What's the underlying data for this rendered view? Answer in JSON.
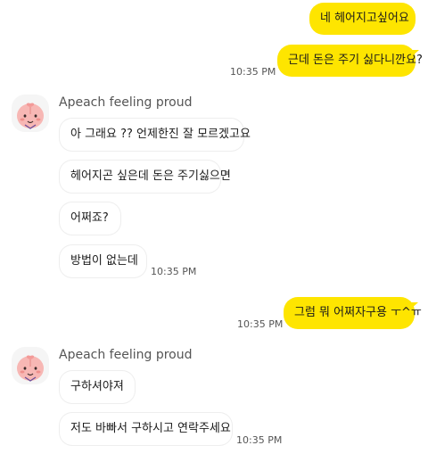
{
  "colors": {
    "my_bubble": "#fee500",
    "their_bubble": "#ffffff",
    "background": "#ffffff",
    "time_text": "#555555"
  },
  "icons": {
    "avatar": "apeach-avatar-icon"
  },
  "chat": {
    "block1": {
      "messages": [
        "네 헤어지고싶어요",
        "근데 돈은 주기 싫다니깐요?"
      ],
      "time": "10:35 PM"
    },
    "block2": {
      "sender": "Apeach feeling proud",
      "messages": [
        "아 그래요 ?? 언제한진 잘 모르겠고요",
        "헤어지곤 싶은데 돈은 주기싫으면",
        "어쩌죠?",
        "방법이 없는데"
      ],
      "time": "10:35 PM"
    },
    "block3": {
      "messages": [
        "그럼 뭐 어쩌자구용 ㅜ^ㅠ"
      ],
      "time": "10:35 PM"
    },
    "block4": {
      "sender": "Apeach feeling proud",
      "messages": [
        "구하셔야져",
        "저도 바빠서 구하시고 연락주세요"
      ],
      "time": "10:35 PM"
    }
  }
}
